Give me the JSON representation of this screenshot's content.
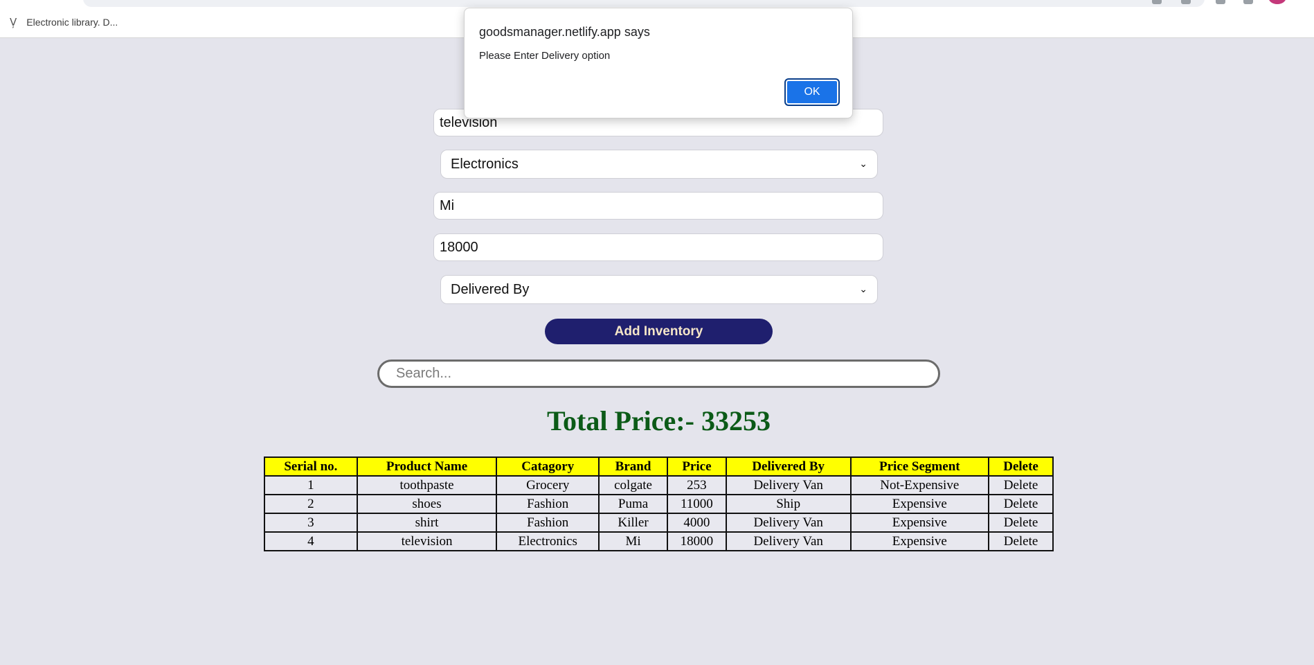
{
  "browser": {
    "bookmark_label": "Electronic library. D..."
  },
  "form": {
    "product_name_value": "television",
    "category_value": "Electronics",
    "brand_value": "Mi",
    "price_value": "18000",
    "delivery_value": "Delivered By",
    "add_button_label": "Add Inventory",
    "search_placeholder": "Search..."
  },
  "total_label": "Total Price:- 33253",
  "table": {
    "headers": [
      "Serial no.",
      "Product Name",
      "Catagory",
      "Brand",
      "Price",
      "Delivered By",
      "Price Segment",
      "Delete"
    ],
    "rows": [
      [
        "1",
        "toothpaste",
        "Grocery",
        "colgate",
        "253",
        "Delivery Van",
        "Not-Expensive",
        "Delete"
      ],
      [
        "2",
        "shoes",
        "Fashion",
        "Puma",
        "11000",
        "Ship",
        "Expensive",
        "Delete"
      ],
      [
        "3",
        "shirt",
        "Fashion",
        "Killer",
        "4000",
        "Delivery Van",
        "Expensive",
        "Delete"
      ],
      [
        "4",
        "television",
        "Electronics",
        "Mi",
        "18000",
        "Delivery Van",
        "Expensive",
        "Delete"
      ]
    ]
  },
  "dialog": {
    "title": "goodsmanager.netlify.app says",
    "message": "Please Enter Delivery option",
    "ok_label": "OK"
  },
  "colors": {
    "page_bg": "#e4e4ec",
    "button_bg": "#1f1f6e",
    "header_bg": "#ffff00",
    "total_color": "#0b5a17",
    "ok_bg": "#1a73e8"
  }
}
